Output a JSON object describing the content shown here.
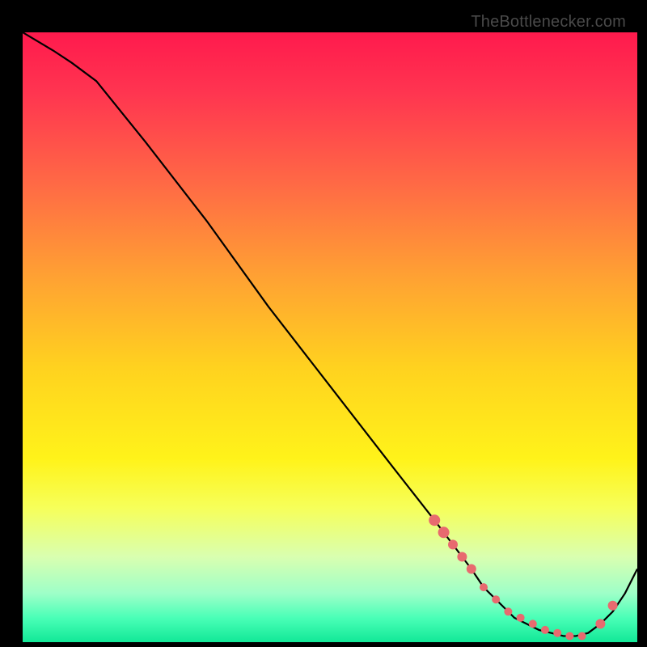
{
  "watermark": "TheBottlenecker.com",
  "gradient": {
    "stops": [
      {
        "offset": 0.0,
        "color": "#ff1a4d"
      },
      {
        "offset": 0.1,
        "color": "#ff3550"
      },
      {
        "offset": 0.25,
        "color": "#ff6a45"
      },
      {
        "offset": 0.4,
        "color": "#ffa133"
      },
      {
        "offset": 0.55,
        "color": "#ffd21f"
      },
      {
        "offset": 0.7,
        "color": "#fff31a"
      },
      {
        "offset": 0.78,
        "color": "#f6ff5a"
      },
      {
        "offset": 0.86,
        "color": "#d9ffb0"
      },
      {
        "offset": 0.92,
        "color": "#9effc8"
      },
      {
        "offset": 0.96,
        "color": "#4affb7"
      },
      {
        "offset": 1.0,
        "color": "#12e897"
      }
    ]
  },
  "chart_data": {
    "type": "line",
    "title": "",
    "xlabel": "",
    "ylabel": "",
    "xlim": [
      0,
      100
    ],
    "ylim": [
      0,
      100
    ],
    "series": [
      {
        "name": "curve",
        "x": [
          0,
          5,
          8,
          12,
          20,
          30,
          40,
          50,
          60,
          67,
          70,
          73,
          75,
          78,
          80,
          82,
          84,
          86,
          88,
          90,
          92,
          94,
          96,
          98,
          100
        ],
        "y": [
          100,
          97,
          95,
          92,
          82,
          69,
          55,
          42,
          29,
          20,
          16,
          12,
          9,
          6,
          4,
          3,
          2,
          1.5,
          1,
          1,
          1.5,
          3,
          5,
          8,
          12
        ]
      }
    ],
    "markers": {
      "name": "dots",
      "x": [
        67,
        68.5,
        70,
        71.5,
        73,
        75,
        77,
        79,
        81,
        83,
        85,
        87,
        89,
        91,
        94,
        96
      ],
      "y": [
        20,
        18,
        16,
        14,
        12,
        9,
        7,
        5,
        4,
        3,
        2,
        1.5,
        1,
        1,
        3,
        6
      ],
      "size": [
        7,
        7,
        6,
        6,
        6,
        5,
        5,
        5,
        5,
        5,
        5,
        5,
        5,
        5,
        6,
        6
      ]
    }
  }
}
